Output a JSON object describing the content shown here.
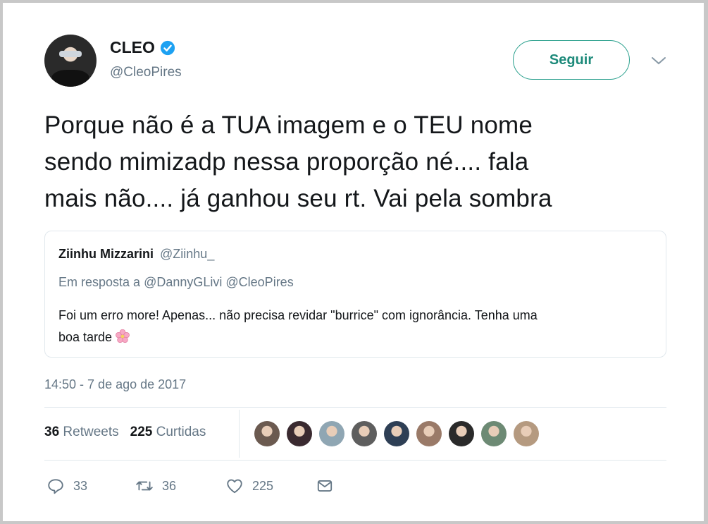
{
  "author": {
    "name": "CLEO",
    "handle": "@CleoPires",
    "verified": true,
    "follow_label": "Seguir"
  },
  "tweet": {
    "line1": "Porque não é a TUA imagem e o TEU nome",
    "line2": "sendo mimizadp nessa proporção né.... fala",
    "line3": "mais não.... já ganhou seu rt. Vai pela sombra"
  },
  "quoted": {
    "name": "Ziinhu Mizzarini",
    "handle": "@Ziinhu_",
    "reply_prefix": "Em resposta a",
    "reply_to": "@DannyGLivi @CleoPires",
    "text_line1": "Foi um erro more! Apenas... não precisa revidar \"burrice\" com ignorância. Tenha uma",
    "text_line2": "boa tarde"
  },
  "timestamp": "14:50 - 7 de ago de 2017",
  "stats": {
    "retweets_count": "36",
    "retweets_label": "Retweets",
    "likes_count": "225",
    "likes_label": "Curtidas"
  },
  "likers": [
    {
      "color": "#6b5a50"
    },
    {
      "color": "#3a2a30"
    },
    {
      "color": "#8fa6b3"
    },
    {
      "color": "#5e5e5e"
    },
    {
      "color": "#2e3f55"
    },
    {
      "color": "#9a7a68"
    },
    {
      "color": "#2a2a2a"
    },
    {
      "color": "#6d8a74"
    },
    {
      "color": "#b59a80"
    }
  ],
  "actions": {
    "replies": "33",
    "retweets": "36",
    "likes": "225"
  },
  "colors": {
    "accent": "#1da1f2",
    "follow": "#1d8a7a",
    "muted": "#657786"
  }
}
